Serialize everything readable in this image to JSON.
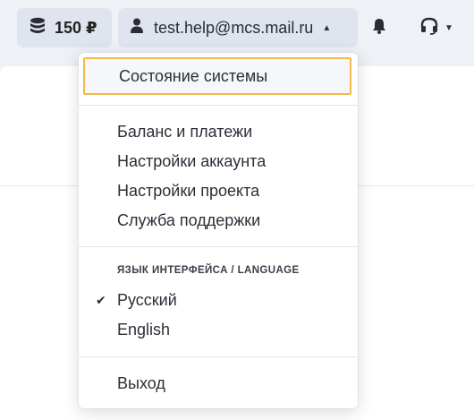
{
  "header": {
    "balance": "150 ₽",
    "email": "test.help@mcs.mail.ru"
  },
  "menu": {
    "status": "Состояние системы",
    "account_items": [
      "Баланс и платежи",
      "Настройки аккаунта",
      "Настройки проекта",
      "Служба поддержки"
    ],
    "language_header": "ЯЗЫК ИНТЕРФЕЙСА / LANGUAGE",
    "languages": [
      "Русский",
      "English"
    ],
    "selected_language": "Русский",
    "logout": "Выход"
  },
  "colors": {
    "focus_outline": "#f3b94a",
    "topbar_bg": "#eef1f6",
    "pill_bg": "#dfe4ee"
  }
}
